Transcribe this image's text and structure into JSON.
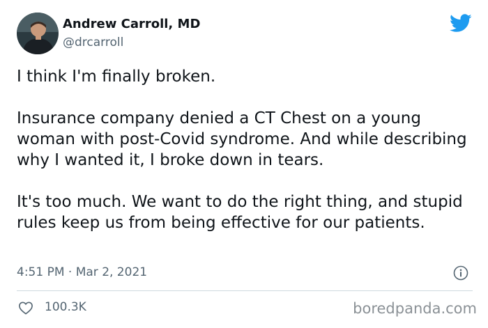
{
  "author": {
    "name": "Andrew Carroll, MD",
    "handle": "@drcarroll"
  },
  "tweet": {
    "paragraphs": [
      "I think I'm finally broken.",
      "Insurance company denied a CT Chest on a young woman with post-Covid syndrome. And while describing why I wanted it, I broke down in tears.",
      "It's too much. We want to do the right thing, and stupid rules keep us from being effective for our patients."
    ],
    "timestamp": "4:51 PM · Mar 2, 2021"
  },
  "stats": {
    "likes": "100.3K"
  },
  "icons": {
    "brand": "twitter-bird-icon",
    "info": "info-icon",
    "like": "heart-icon"
  },
  "colors": {
    "twitter_blue": "#1d9bf0",
    "text_primary": "#0f1419",
    "text_secondary": "#536471"
  },
  "watermark": "boredpanda.com"
}
